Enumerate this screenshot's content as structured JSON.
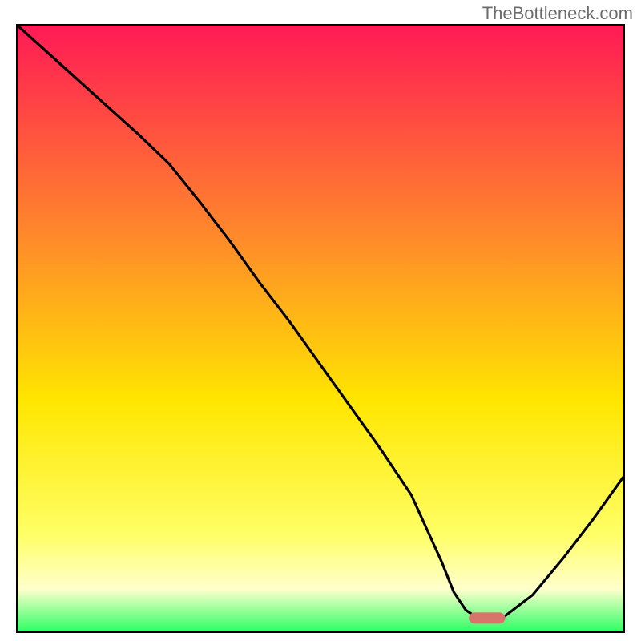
{
  "watermark": "TheBottleneck.com",
  "colors": {
    "gradient_top": "#ff1a55",
    "gradient_mid1": "#ff8a2a",
    "gradient_mid2": "#ffe600",
    "gradient_mid3": "#ffff66",
    "gradient_mid4": "#ffffcc",
    "gradient_bottom": "#2eff66",
    "curve": "#000000",
    "marker": "#d9746b"
  },
  "chart_data": {
    "type": "line",
    "title": "",
    "xlabel": "",
    "ylabel": "",
    "xlim": [
      0,
      1
    ],
    "ylim": [
      0,
      1
    ],
    "series": [
      {
        "name": "bottleneck-curve",
        "x": [
          0.0,
          0.05,
          0.1,
          0.15,
          0.2,
          0.25,
          0.3,
          0.35,
          0.4,
          0.45,
          0.5,
          0.55,
          0.6,
          0.65,
          0.7,
          0.72,
          0.74,
          0.76,
          0.78,
          0.8,
          0.85,
          0.9,
          0.95,
          1.0
        ],
        "y": [
          1.0,
          0.955,
          0.91,
          0.865,
          0.82,
          0.772,
          0.71,
          0.645,
          0.575,
          0.51,
          0.44,
          0.37,
          0.3,
          0.225,
          0.115,
          0.065,
          0.035,
          0.022,
          0.022,
          0.022,
          0.06,
          0.12,
          0.185,
          0.255
        ]
      }
    ],
    "marker": {
      "name": "optimal-range",
      "x_start": 0.745,
      "x_end": 0.805,
      "y": 0.022
    },
    "grid": false,
    "legend": false
  }
}
